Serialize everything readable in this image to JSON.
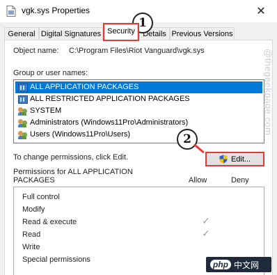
{
  "window": {
    "title": "vgk.sys Properties",
    "close_symbol": "✕"
  },
  "tabs": [
    {
      "label": "General"
    },
    {
      "label": "Digital Signatures"
    },
    {
      "label": "Security"
    },
    {
      "label": "Details"
    },
    {
      "label": "Previous Versions"
    }
  ],
  "object": {
    "label": "Object name:",
    "value": "C:\\Program Files\\Riot Vanguard\\vgk.sys"
  },
  "groups": {
    "label": "Group or user names:",
    "items": [
      {
        "name": "ALL APPLICATION PACKAGES",
        "icon": "package-icon"
      },
      {
        "name": "ALL RESTRICTED APPLICATION PACKAGES",
        "icon": "package-icon"
      },
      {
        "name": "SYSTEM",
        "icon": "users-icon"
      },
      {
        "name": "Administrators (Windows11Pro\\Administrators)",
        "icon": "users-icon"
      },
      {
        "name": "Users (Windows11Pro\\Users)",
        "icon": "users-icon"
      }
    ]
  },
  "change_permissions": {
    "text": "To change permissions, click Edit.",
    "edit_label": "Edit..."
  },
  "permissions": {
    "title": "Permissions for ALL APPLICATION PACKAGES",
    "allow_label": "Allow",
    "deny_label": "Deny",
    "rows": [
      {
        "name": "Full control",
        "allow": false,
        "deny": false
      },
      {
        "name": "Modify",
        "allow": false,
        "deny": false
      },
      {
        "name": "Read & execute",
        "allow": true,
        "deny": false
      },
      {
        "name": "Read",
        "allow": true,
        "deny": false
      },
      {
        "name": "Write",
        "allow": false,
        "deny": false
      },
      {
        "name": "Special permissions",
        "allow": false,
        "deny": false
      }
    ],
    "check_symbol": "✓"
  },
  "annotations": {
    "step1": "1",
    "step2": "2",
    "color": "#e53935"
  },
  "watermark": "@thegeekpage.com",
  "logo": {
    "mark": "php",
    "text": "中文网"
  }
}
